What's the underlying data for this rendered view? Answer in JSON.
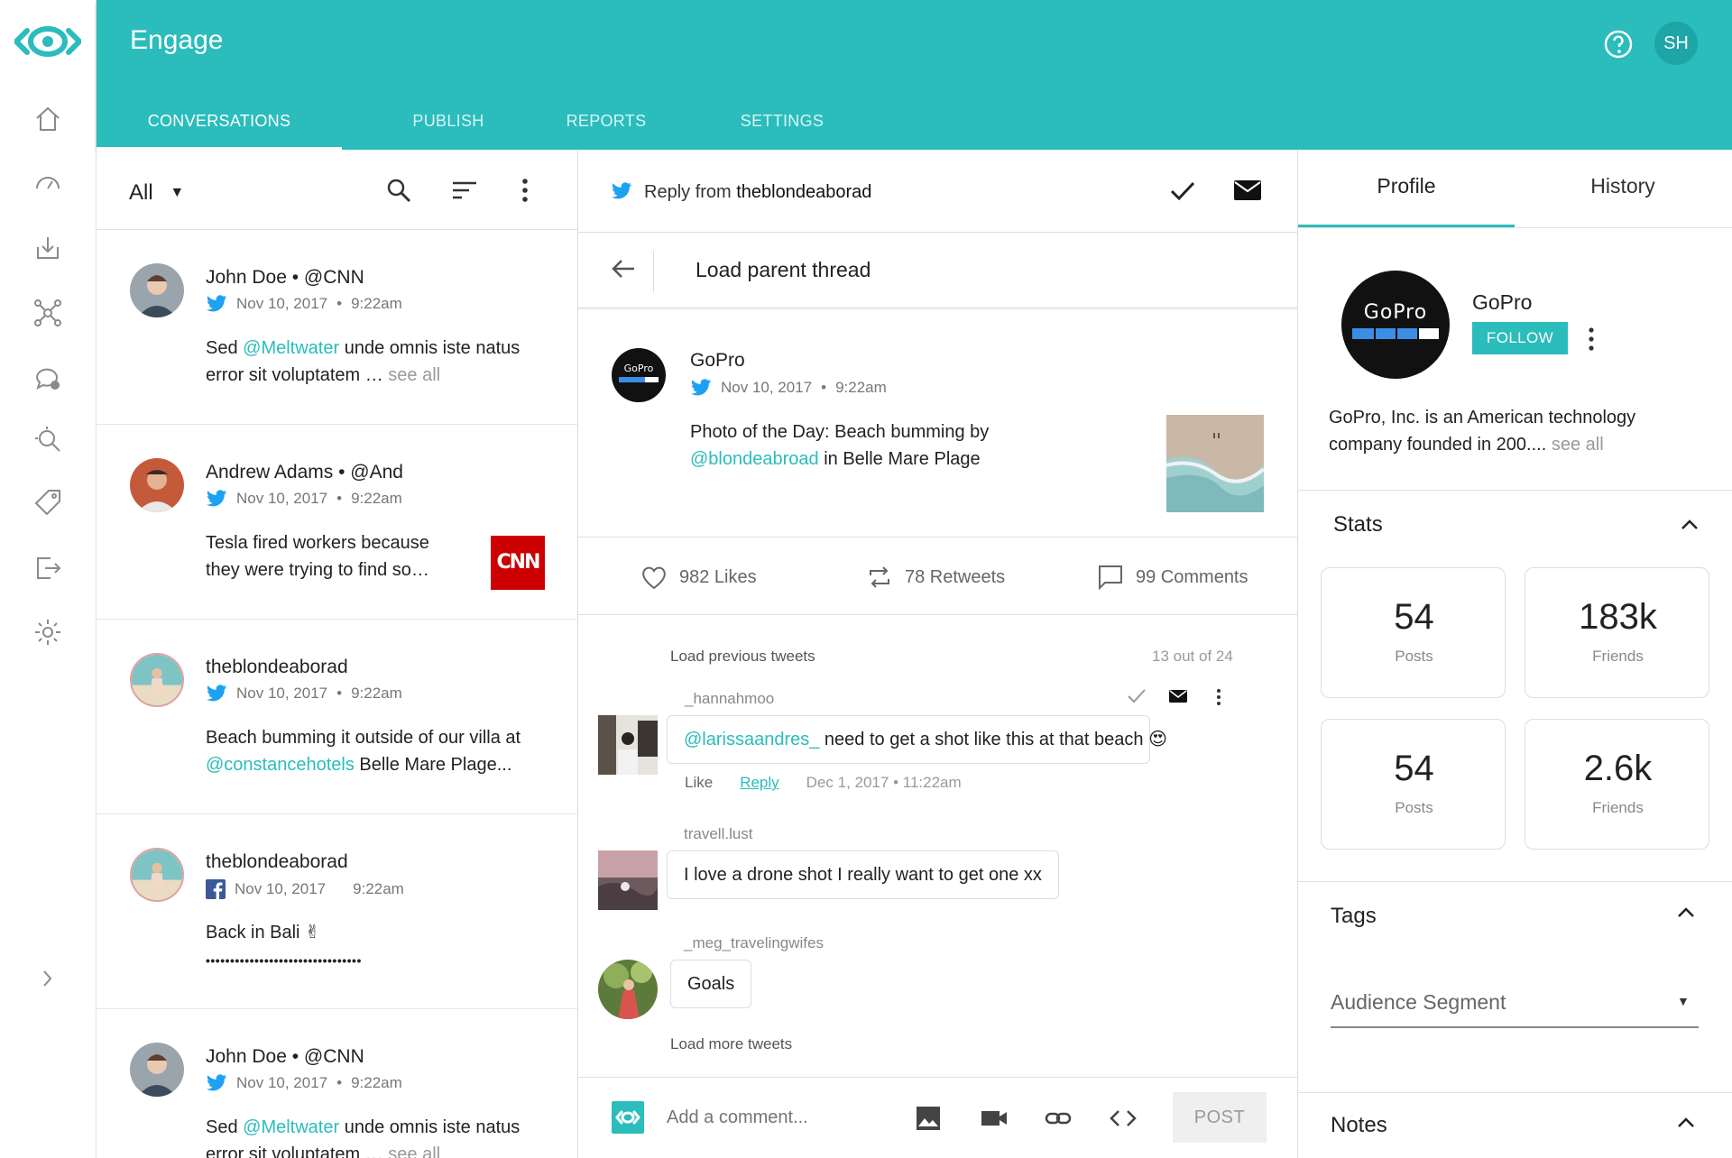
{
  "app": {
    "title": "Engage",
    "user_initials": "SH"
  },
  "nav_tabs": [
    {
      "label": "CONVERSATIONS",
      "active": true
    },
    {
      "label": "PUBLISH",
      "active": false
    },
    {
      "label": "REPORTS",
      "active": false
    },
    {
      "label": "SETTINGS",
      "active": false
    }
  ],
  "rail_icons": [
    "home-icon",
    "dashboard-icon",
    "inbox-download-icon",
    "network-icon",
    "chat-icon",
    "search-insights-icon",
    "tag-icon",
    "export-icon",
    "settings-gear-icon",
    "chevron-right-icon"
  ],
  "list": {
    "filter": "All",
    "items": [
      {
        "name": "John Doe • @CNN",
        "source": "twitter",
        "date": "Nov 10, 2017",
        "sep": "•",
        "time": "9:22am",
        "text_pre": "Sed ",
        "mention": "@Meltwater",
        "text_post": " unde omnis iste natus error sit voluptatem … ",
        "see_all": "see all"
      },
      {
        "name": "Andrew Adams • @And",
        "source": "twitter",
        "date": "Nov 10, 2017",
        "sep": "•",
        "time": "9:22am",
        "text_pre": "Tesla fired workers because they were trying to find so…",
        "mention": "",
        "text_post": "",
        "see_all": "",
        "thumb": "CNN"
      },
      {
        "name": "theblondeaborad",
        "source": "twitter",
        "date": "Nov 10, 2017",
        "sep": "•",
        "time": "9:22am",
        "text_pre": "Beach bumming it outside of our villa at ",
        "mention": "@constancehotels",
        "text_post": " Belle Mare Plage...",
        "see_all": ""
      },
      {
        "name": "theblondeaborad",
        "source": "facebook",
        "date": "Nov 10, 2017",
        "sep": "",
        "time": "9:22am",
        "text_pre": "Back in Bali ✌",
        "mention": "",
        "text_post": "",
        "see_all": "",
        "dots": "••••••••••••••••••••••••••••••••"
      },
      {
        "name": "John Doe • @CNN",
        "source": "twitter",
        "date": "Nov 10, 2017",
        "sep": "•",
        "time": "9:22am",
        "text_pre": "Sed ",
        "mention": "@Meltwater",
        "text_post": " unde omnis iste natus error sit voluptatem … ",
        "see_all": "see all"
      }
    ]
  },
  "thread": {
    "reply_prefix": "Reply from ",
    "reply_user": "theblondeaborad",
    "load_parent": "Load parent thread",
    "post": {
      "author": "GoPro",
      "date": "Nov 10, 2017",
      "sep": "•",
      "time": "9:22am",
      "text_pre": "Photo of the Day: Beach bumming by ",
      "mention": "@blondeabroad",
      "text_post": " in Belle Mare Plage"
    },
    "likes": "982 Likes",
    "retweets": "78 Retweets",
    "comments": "99 Comments",
    "load_previous": "Load previous tweets",
    "count": "13 out of 24",
    "replies": [
      {
        "user": "_hannahmoo",
        "mention": "@larissaandres_",
        "text": " need to get a shot like this at that beach 😍",
        "like": "Like",
        "reply": "Reply",
        "date": "Dec 1, 2017",
        "sep": "•",
        "time": "11:22am"
      },
      {
        "user": "travell.lust",
        "mention": "",
        "text": "I love a drone shot I really want to get one xx"
      },
      {
        "user": "_meg_travelingwifes",
        "mention": "",
        "text": "Goals"
      }
    ],
    "load_more": "Load more tweets",
    "composer_placeholder": "Add a comment...",
    "post_button": "POST"
  },
  "profile": {
    "tabs": [
      "Profile",
      "History"
    ],
    "name": "GoPro",
    "follow": "FOLLOW",
    "bio": "GoPro, Inc. is an American technology company founded in 200.... ",
    "bio_see_all": "see all",
    "stats_title": "Stats",
    "stats": [
      {
        "value": "54",
        "label": "Posts"
      },
      {
        "value": "183k",
        "label": "Friends"
      },
      {
        "value": "54",
        "label": "Posts"
      },
      {
        "value": "2.6k",
        "label": "Friends"
      }
    ],
    "tags_title": "Tags",
    "segment_placeholder": "Audience Segment",
    "notes_title": "Notes",
    "logo_text": "GoPro"
  },
  "colors": {
    "accent": "#2bbcbc",
    "twitter": "#1da1f2",
    "facebook": "#3b5998",
    "cnn": "#cc0000"
  }
}
